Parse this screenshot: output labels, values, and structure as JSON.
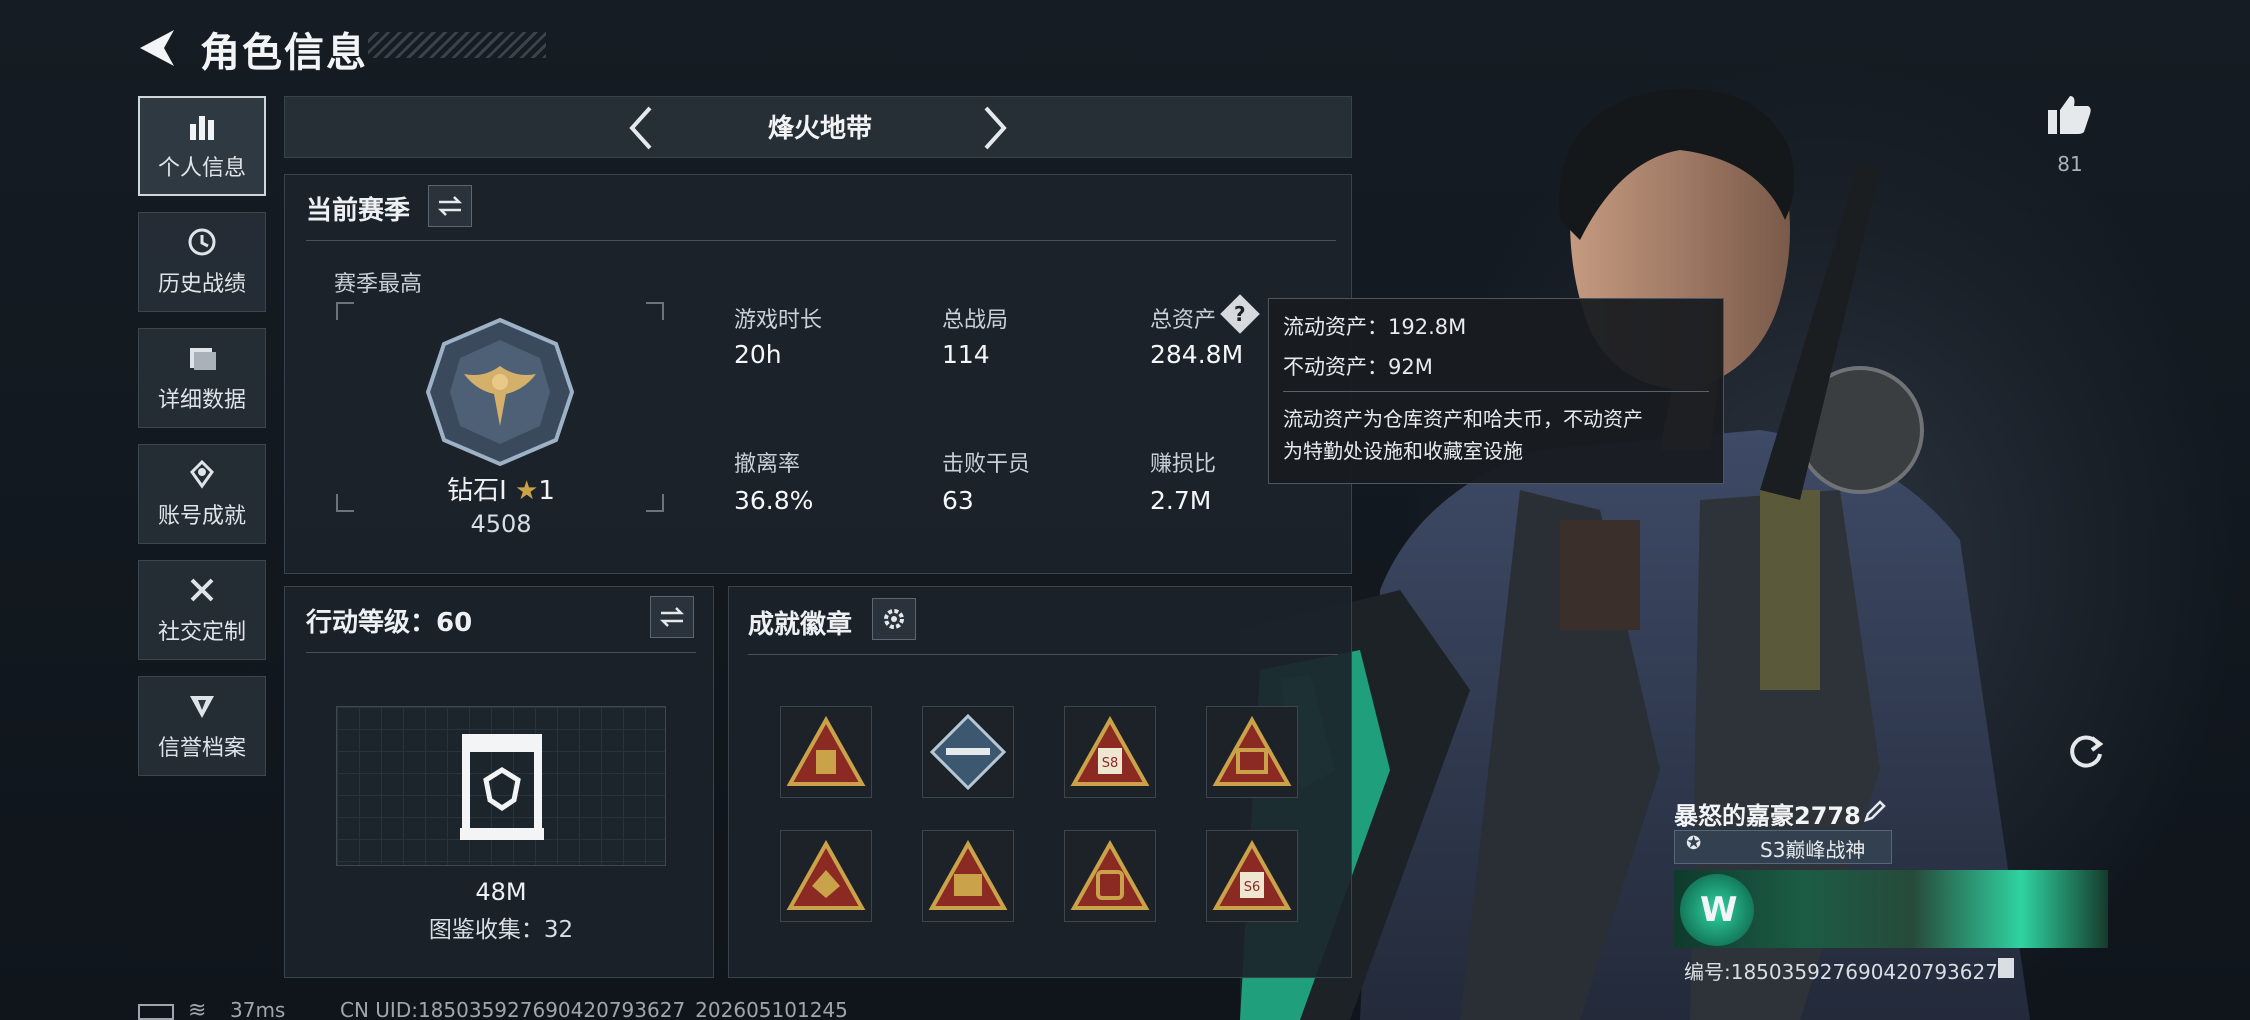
{
  "header": {
    "title": "角色信息"
  },
  "sidebar": {
    "items": [
      {
        "label": "个人信息",
        "icon": "bar-chart-icon",
        "active": true
      },
      {
        "label": "历史战绩",
        "icon": "history-icon"
      },
      {
        "label": "详细数据",
        "icon": "folder-icon"
      },
      {
        "label": "账号成就",
        "icon": "achievement-icon"
      },
      {
        "label": "社交定制",
        "icon": "tools-icon"
      },
      {
        "label": "信誉档案",
        "icon": "shield-icon"
      }
    ]
  },
  "mode": {
    "title": "烽火地带"
  },
  "season": {
    "title": "当前赛季",
    "best_label": "赛季最高",
    "rank_name": "钻石Ⅰ",
    "rank_stars": "1",
    "rank_points": "4508",
    "stats": [
      {
        "label": "游戏时长",
        "value": "20h"
      },
      {
        "label": "总战局",
        "value": "114"
      },
      {
        "label": "总资产",
        "value": "284.8M"
      },
      {
        "label": "撤离率",
        "value": "36.8%"
      },
      {
        "label": "击败干员",
        "value": "63"
      },
      {
        "label": "赚损比",
        "value": "2.7M"
      }
    ]
  },
  "tooltip": {
    "liquid": "流动资产：192.8M",
    "fixed": "不动资产：92M",
    "desc_line1": "流动资产为仓库资产和哈夫币，不动资产",
    "desc_line2": "为特勤处设施和收藏室设施"
  },
  "action_level": {
    "title": "行动等级：60",
    "value": "48M",
    "collection": "图鉴收集：32"
  },
  "badges": {
    "title": "成就徽章",
    "items": [
      {
        "icon": "backpack-badge-icon"
      },
      {
        "icon": "rifle-badge-icon"
      },
      {
        "icon": "s8-badge-icon",
        "text": "S8"
      },
      {
        "icon": "crate-badge-icon"
      },
      {
        "icon": "eagle-badge-icon"
      },
      {
        "icon": "crate-badge-icon"
      },
      {
        "icon": "backpack-badge-icon"
      },
      {
        "icon": "s6-badge-icon",
        "text": "S6"
      }
    ]
  },
  "likes": {
    "count": "81"
  },
  "player": {
    "name": "暴怒的嘉豪2778",
    "title": "S3巅峰战神",
    "id": "编号:185035927690420793627"
  },
  "status": {
    "ping": "37ms",
    "uid": "CN UID:185035927690420793627_202605101245"
  },
  "colors": {
    "accent_gold": "#c9a24a",
    "badge_red": "#8b2a22",
    "teal": "#2fd3a0"
  }
}
